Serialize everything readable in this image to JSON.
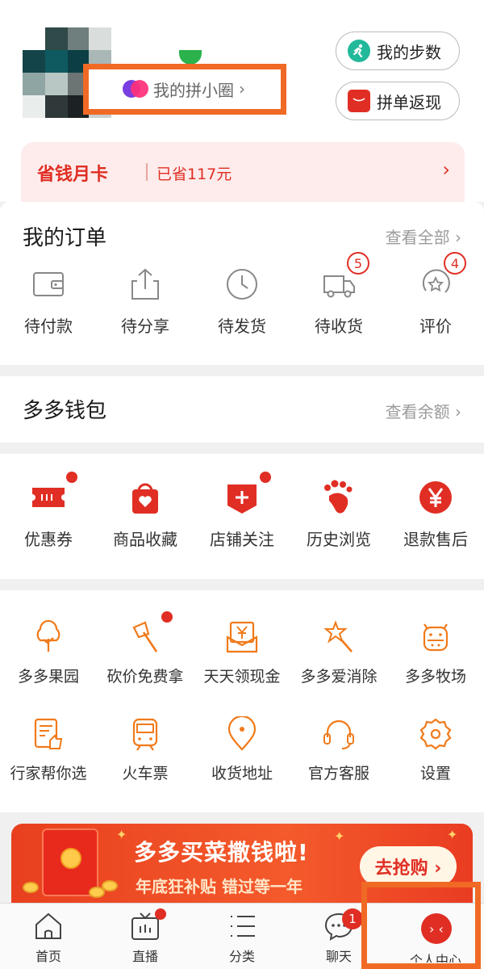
{
  "header": {
    "circle_label": "我的拼小圈",
    "circle_arrow": "›",
    "steps_label": "我的步数",
    "refund_label": "拼单返现"
  },
  "card": {
    "title": "省钱月卡",
    "saved": "已省117元",
    "arrow": "›"
  },
  "orders": {
    "title": "我的订单",
    "more": "查看全部",
    "more_arrow": "›",
    "items": [
      {
        "label": "待付款",
        "icon": "wallet-icon"
      },
      {
        "label": "待分享",
        "icon": "share-icon"
      },
      {
        "label": "待发货",
        "icon": "clock-icon"
      },
      {
        "label": "待收货",
        "icon": "truck-icon",
        "badge": "5"
      },
      {
        "label": "评价",
        "icon": "star-review-icon",
        "badge": "4"
      }
    ]
  },
  "wallet": {
    "title": "多多钱包",
    "more": "查看余额",
    "more_arrow": "›"
  },
  "services": [
    {
      "label": "优惠券",
      "icon": "ticket-icon",
      "dot": true
    },
    {
      "label": "商品收藏",
      "icon": "bag-heart-icon",
      "dot": false
    },
    {
      "label": "店铺关注",
      "icon": "store-plus-icon",
      "dot": true
    },
    {
      "label": "历史浏览",
      "icon": "footprint-icon",
      "dot": false
    },
    {
      "label": "退款售后",
      "icon": "yen-icon",
      "dot": false
    }
  ],
  "tools": [
    {
      "label": "多多果园",
      "icon": "tree-icon"
    },
    {
      "label": "砍价免费拿",
      "icon": "axe-icon",
      "dot": true
    },
    {
      "label": "天天领现金",
      "icon": "cash-envelope-icon"
    },
    {
      "label": "多多爱消除",
      "icon": "star-wand-icon"
    },
    {
      "label": "多多牧场",
      "icon": "cow-icon"
    },
    {
      "label": "行家帮你选",
      "icon": "thumbs-doc-icon"
    },
    {
      "label": "火车票",
      "icon": "train-icon"
    },
    {
      "label": "收货地址",
      "icon": "location-icon"
    },
    {
      "label": "官方客服",
      "icon": "headset-icon"
    },
    {
      "label": "设置",
      "icon": "gear-icon"
    }
  ],
  "banner": {
    "title": "多多买菜撒钱啦!",
    "subtitle": "年底狂补贴 错过等一年",
    "button": "去抢购 ›"
  },
  "tabbar": {
    "items": [
      {
        "label": "首页",
        "icon": "home-icon"
      },
      {
        "label": "直播",
        "icon": "tv-icon",
        "dot": true
      },
      {
        "label": "分类",
        "icon": "list-icon"
      },
      {
        "label": "聊天",
        "icon": "chat-icon",
        "badge": "1"
      },
      {
        "label": "个人中心",
        "icon": "profile-face-icon"
      }
    ]
  },
  "colors": {
    "accent": "#e02e24",
    "highlight_box": "#f06a25",
    "tool_icon": "#f07a1a"
  }
}
